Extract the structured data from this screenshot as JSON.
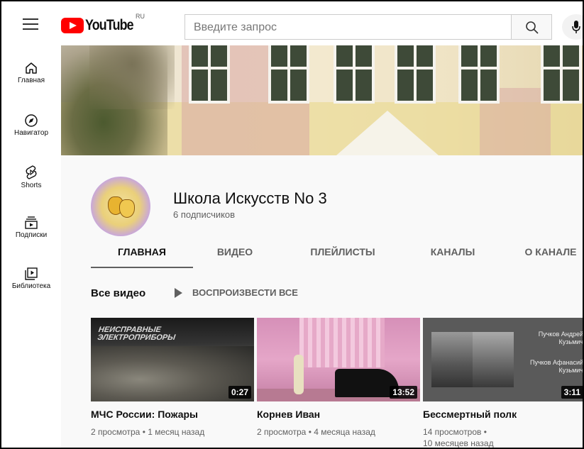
{
  "header": {
    "logo_text": "YouTube",
    "region": "RU",
    "search_placeholder": "Введите запрос"
  },
  "sidebar": {
    "items": [
      {
        "label": "Главная",
        "icon": "home-icon"
      },
      {
        "label": "Навигатор",
        "icon": "compass-icon"
      },
      {
        "label": "Shorts",
        "icon": "shorts-icon"
      },
      {
        "label": "Подписки",
        "icon": "subscriptions-icon"
      },
      {
        "label": "Библиотека",
        "icon": "library-icon"
      }
    ]
  },
  "channel": {
    "name": "Школа Искусств No 3",
    "subscribers": "6 подписчиков"
  },
  "tabs": [
    {
      "label": "ГЛАВНАЯ",
      "active": true
    },
    {
      "label": "ВИДЕО",
      "active": false
    },
    {
      "label": "ПЛЕЙЛИСТЫ",
      "active": false
    },
    {
      "label": "КАНАЛЫ",
      "active": false
    },
    {
      "label": "О КАНАЛЕ",
      "active": false
    }
  ],
  "section": {
    "title": "Все видео",
    "play_all": "ВОСПРОИЗВЕСТИ ВСЕ"
  },
  "videos": [
    {
      "title": "МЧС России: Пожары",
      "meta_line1": "2 просмотра • 1 месяц назад",
      "meta_line2": "",
      "duration": "0:27",
      "thumb_text": "НЕИСПРАВНЫЕ ЭЛЕКТРОПРИБОРЫ"
    },
    {
      "title": "Корнев Иван",
      "meta_line1": "2 просмотра • 4 месяца назад",
      "meta_line2": "",
      "duration": "13:52"
    },
    {
      "title": "Бессмертный полк",
      "meta_line1": "14 просмотров •",
      "meta_line2": "10 месяцев назад",
      "duration": "3:11",
      "thumb_name1": "Пучков Андрей Кузьмич",
      "thumb_name2": "Пучков Афанасий Кузьмич"
    }
  ],
  "colors": {
    "brand_red": "#ff0000",
    "text_primary": "#0f0f0f",
    "text_secondary": "#606060"
  }
}
